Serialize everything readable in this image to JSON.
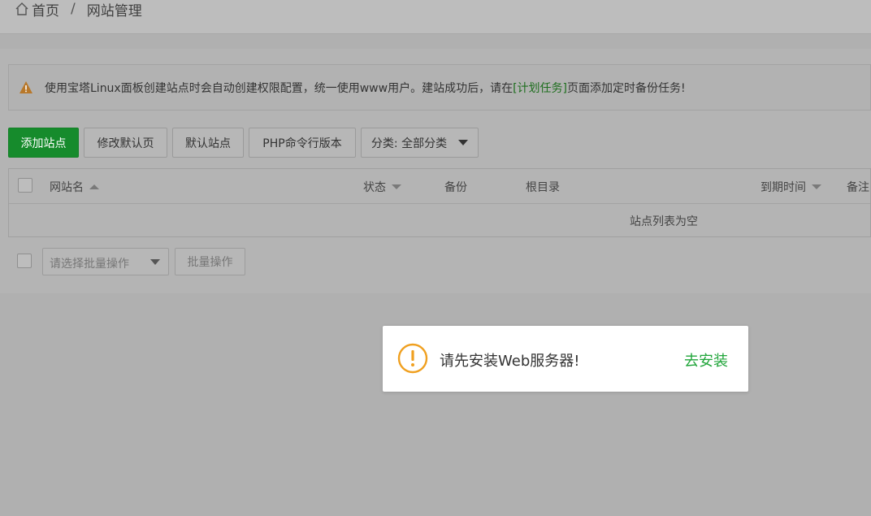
{
  "breadcrumb": {
    "home": "首页",
    "separator": "/",
    "current": "网站管理"
  },
  "notice": {
    "text_before": "使用宝塔Linux面板创建站点时会自动创建权限配置，统一使用www用户。建站成功后，请在",
    "link": "[计划任务]",
    "text_after": "页面添加定时备份任务!"
  },
  "toolbar": {
    "add_site": "添加站点",
    "edit_default_page": "修改默认页",
    "default_site": "默认站点",
    "php_cli_version": "PHP命令行版本",
    "category_select": "分类: 全部分类"
  },
  "table": {
    "columns": {
      "site_name": "网站名",
      "status": "状态",
      "backup": "备份",
      "root_dir": "根目录",
      "expire_time": "到期时间",
      "remark": "备注"
    },
    "empty_text": "站点列表为空"
  },
  "batch": {
    "placeholder": "请选择批量操作",
    "button": "批量操作"
  },
  "toast": {
    "message": "请先安装Web服务器!",
    "action": "去安装"
  },
  "colors": {
    "primary": "#168b2c",
    "warning": "#f0a020",
    "link_green": "#20a53a"
  }
}
